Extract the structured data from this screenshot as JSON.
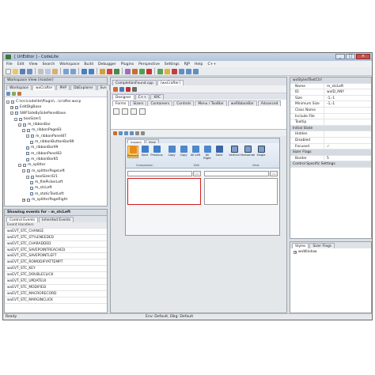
{
  "window": {
    "title": "[ UrlEditor ] - CodeLite",
    "btn_min": "_",
    "btn_max": "□",
    "btn_close": "×"
  },
  "menu": [
    "File",
    "Edit",
    "View",
    "Search",
    "Workspace",
    "Build",
    "Debugger",
    "Plugins",
    "Perspective",
    "Settings",
    "RJP",
    "Help",
    "C++"
  ],
  "workspace_view": {
    "header": "Workspace View (master)",
    "tabs": [
      "Workspace",
      "wxCrafter",
      "PHP",
      "DbExplorer",
      "Svn"
    ],
    "active_tab": 1,
    "tree": [
      {
        "label": "C:\\src\\codelite\\Plugin\\...\\crafter.wxcp",
        "depth": 0,
        "exp": "-"
      },
      {
        "label": "EditDlgBase",
        "depth": 1,
        "exp": "+"
      },
      {
        "label": "SWFSideBySidePanelBase",
        "depth": 1,
        "exp": "-"
      },
      {
        "label": "boxSizer1",
        "depth": 2,
        "exp": "-"
      },
      {
        "label": "m_ribbonBar",
        "depth": 3,
        "exp": "-"
      },
      {
        "label": "m_ribbonPage83",
        "depth": 4,
        "exp": "-"
      },
      {
        "label": "m_ribbonPanel87",
        "depth": 5,
        "exp": "-"
      },
      {
        "label": "m_ribbonButtonBar89",
        "depth": 6,
        "exp": ""
      },
      {
        "label": "m_ribbonBar99",
        "depth": 5,
        "exp": ""
      },
      {
        "label": "m_ribbonPanel83",
        "depth": 5,
        "exp": ""
      },
      {
        "label": "m_ribbonBar85",
        "depth": 5,
        "exp": ""
      },
      {
        "label": "m_splitter",
        "depth": 3,
        "exp": "-"
      },
      {
        "label": "m_splitterPageLeft",
        "depth": 4,
        "exp": "-"
      },
      {
        "label": "boxSizer421",
        "depth": 5,
        "exp": "-"
      },
      {
        "label": "m_filePickerLeft",
        "depth": 6,
        "exp": ""
      },
      {
        "label": "m_stcLeft",
        "depth": 6,
        "exp": ""
      },
      {
        "label": "m_staticTextLeft",
        "depth": 6,
        "exp": ""
      },
      {
        "label": "m_splitterPageRight",
        "depth": 4,
        "exp": "+"
      }
    ]
  },
  "events": {
    "header": "Showing events for - m_stcLeft",
    "tabs": [
      "Control Events",
      "Inherited Events"
    ],
    "column": "Event Handlers",
    "rows": [
      "wxEVT_STC_CHANGE",
      "wxEVT_STC_STYLENEEDED",
      "wxEVT_STC_CHARADDED",
      "wxEVT_STC_SAVEPOINTREACHED",
      "wxEVT_STC_SAVEPOINTLEFT",
      "wxEVT_STC_ROMODIFYATTEMPT",
      "wxEVT_STC_KEY",
      "wxEVT_STC_DOUBLECLICK",
      "wxEVT_STC_UPDATEUI",
      "wxEVT_STC_MODIFIED",
      "wxEVT_STC_MACRORECORD",
      "wxEVT_STC_MARGINCLICK"
    ]
  },
  "editor": {
    "file_tabs": [
      "CompletionFound.cpp",
      "[wxCrafter]"
    ],
    "designer_tabs": [
      "Designer",
      "C++",
      "XRC"
    ],
    "control_tabs": [
      "Forms",
      "Sizers",
      "Containers",
      "Controls",
      "Menu / ToolBar",
      "wxRibbonBar",
      "Advanced"
    ],
    "ribbon_tabs": [
      "Inspect",
      "View"
    ],
    "ribbon_buttons": [
      "Refresh",
      "Next",
      "Previous",
      "Copy",
      "Copy",
      "All Left",
      "All Right",
      "Save",
      "Vertical",
      "Horizontal",
      "Single"
    ],
    "group_labels": [
      "Comparison",
      "Edit",
      "View"
    ],
    "picker_btn": "..."
  },
  "properties": {
    "sections": [
      {
        "title": "wxStyledTextCtrl",
        "rows": [
          [
            "Name",
            "m_stcLeft"
          ],
          [
            "ID",
            "wxID_ANY"
          ],
          [
            "Size",
            "-1,-1"
          ],
          [
            "Minimum Size",
            "-1,-1"
          ],
          [
            "Class Name",
            ""
          ],
          [
            "Include File",
            ""
          ],
          [
            "Tooltip",
            ""
          ]
        ]
      },
      {
        "title": "Initial State",
        "rows": [
          [
            "Hidden",
            ""
          ],
          [
            "Disabled",
            ""
          ],
          [
            "Focused",
            "✓"
          ]
        ]
      },
      {
        "title": "Sizer Flags",
        "rows": [
          [
            "Border",
            "5"
          ]
        ]
      },
      {
        "title": "Control Specific Settings",
        "rows": []
      }
    ],
    "bottom_tabs": [
      "Styles",
      "Sizer Flags"
    ],
    "bottom_items": [
      "wxWindow"
    ]
  },
  "status": {
    "left": "Ready",
    "right": "Env: Default, Dbg: Default"
  }
}
